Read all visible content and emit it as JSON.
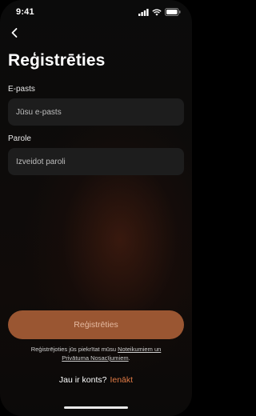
{
  "status_bar": {
    "time": "9:41"
  },
  "header": {
    "title": "Reģistrēties"
  },
  "form": {
    "email": {
      "label": "E-pasts",
      "placeholder": "Jūsu e-pasts"
    },
    "password": {
      "label": "Parole",
      "placeholder": "Izveidot paroli"
    }
  },
  "submit": {
    "label": "Reģistrēties"
  },
  "terms": {
    "prefix": "Reģistrējoties jūs piekrītat mūsu ",
    "terms_link": "Noteikumiem un",
    "privacy_link": "Privātuma Nosacījumiem",
    "suffix": "."
  },
  "login": {
    "prompt": "Jau ir konts?",
    "link": "Ienākt"
  },
  "colors": {
    "accent": "#e07a45",
    "button": "#9a5632",
    "field": "#1d1d1d"
  },
  "icons": [
    "back-arrow-icon",
    "signal-icon",
    "wifi-icon",
    "battery-icon"
  ]
}
